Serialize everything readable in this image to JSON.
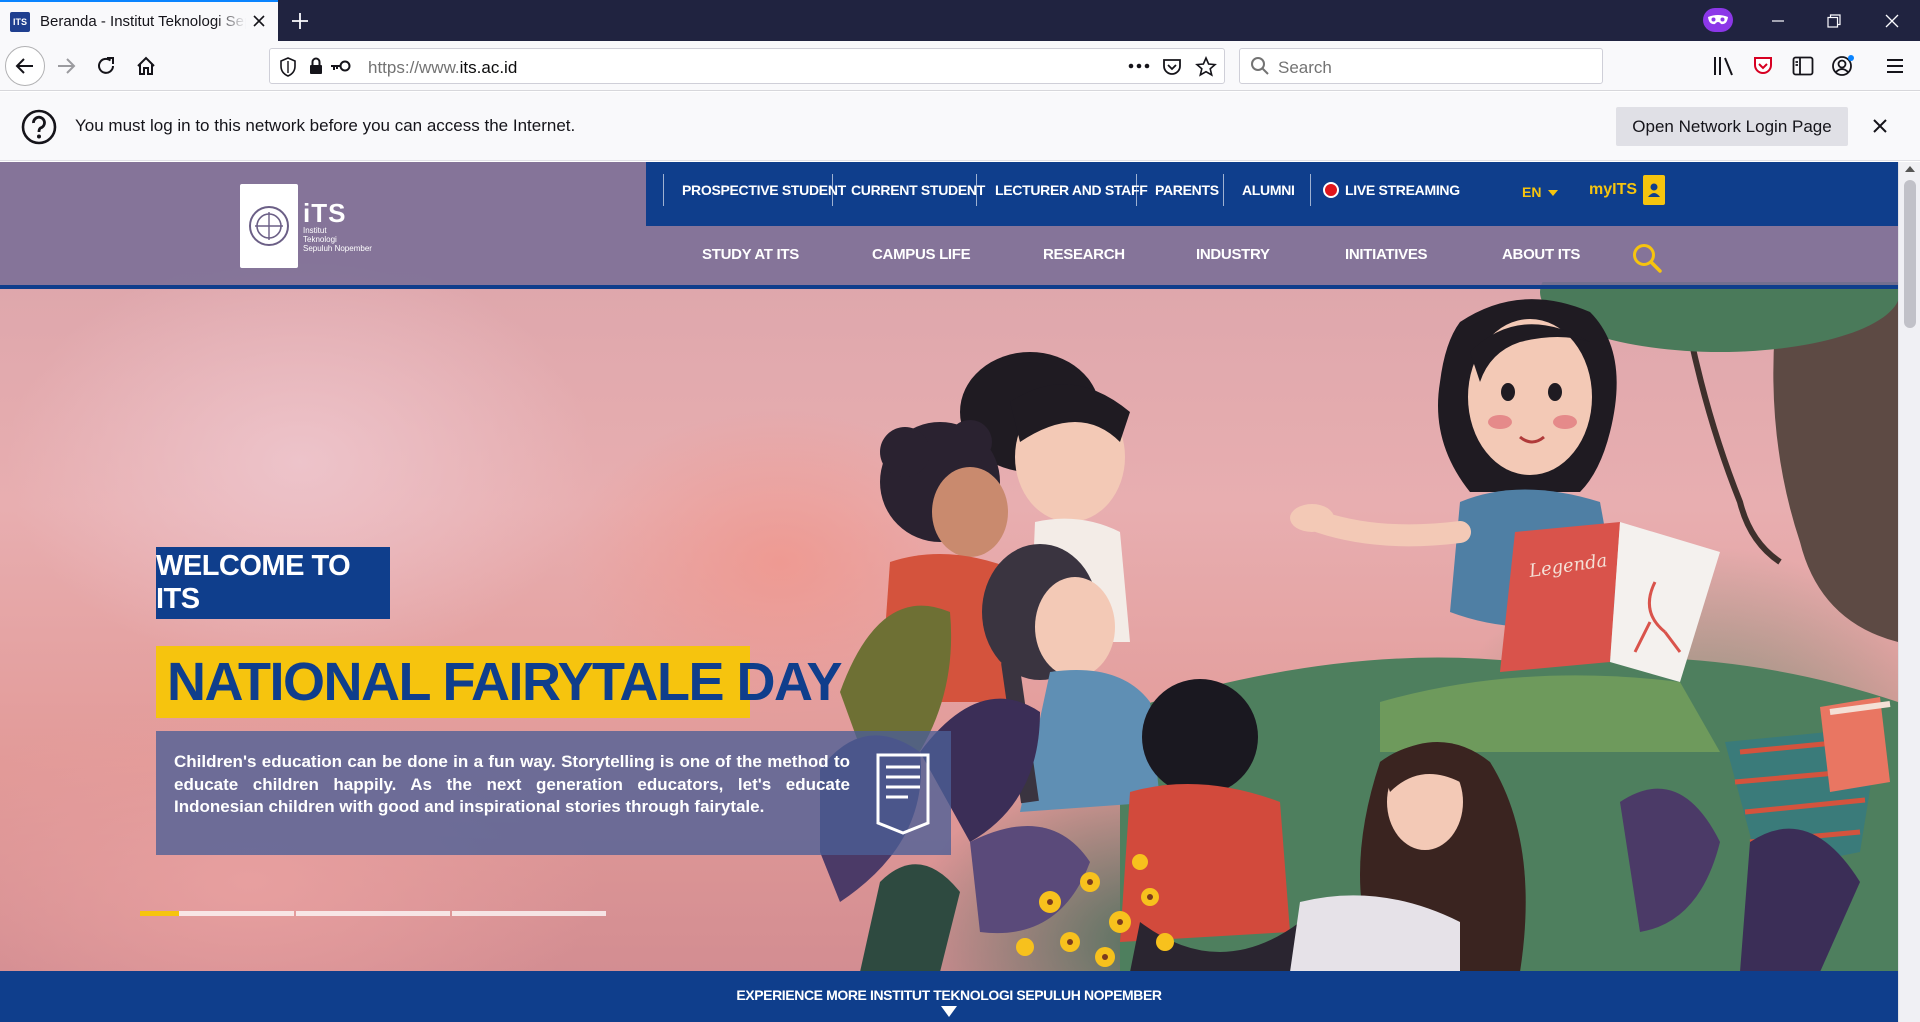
{
  "browser": {
    "tab_title": "Beranda - Institut Teknologi Sepuluh Nopember",
    "favicon_text": "ITS",
    "url_prefix": "https://www.",
    "url_domain": "its.ac.id",
    "search_placeholder": "Search"
  },
  "notification": {
    "message": "You must log in to this network before you can access the Internet.",
    "button_label": "Open Network Login Page"
  },
  "site": {
    "logo_title": "iTS",
    "logo_sub": [
      "Institut",
      "Teknologi",
      "Sepuluh Nopember"
    ],
    "topbar": [
      "PROSPECTIVE STUDENT",
      "CURRENT STUDENT",
      "LECTURER AND STAFF",
      "PARENTS",
      "ALUMNI"
    ],
    "live_streaming": "LIVE STREAMING",
    "language": "EN",
    "myits": "myITS",
    "mainnav": [
      "STUDY AT ITS",
      "CAMPUS LIFE",
      "RESEARCH",
      "INDUSTRY",
      "INITIATIVES",
      "ABOUT ITS"
    ]
  },
  "hero": {
    "welcome": "WELCOME TO ITS",
    "headline": "NATIONAL FAIRYTALE DAY",
    "description": "Children's education can be done in a fun way. Storytelling is one of the method to educate children happily. As the next generation educators, let's educate Indonesian children with good and inspirational stories through fairytale.",
    "book_label": "Legenda",
    "slide_progress": 0.25,
    "slide_count": 3
  },
  "footer_bar": {
    "text": "EXPERIENCE MORE INSTITUT TEKNOLOGI SEPULUH NOPEMBER"
  },
  "colors": {
    "brand_blue": "#0f3e8c",
    "brand_yellow": "#f6c40e",
    "live_red": "#e0161c"
  }
}
